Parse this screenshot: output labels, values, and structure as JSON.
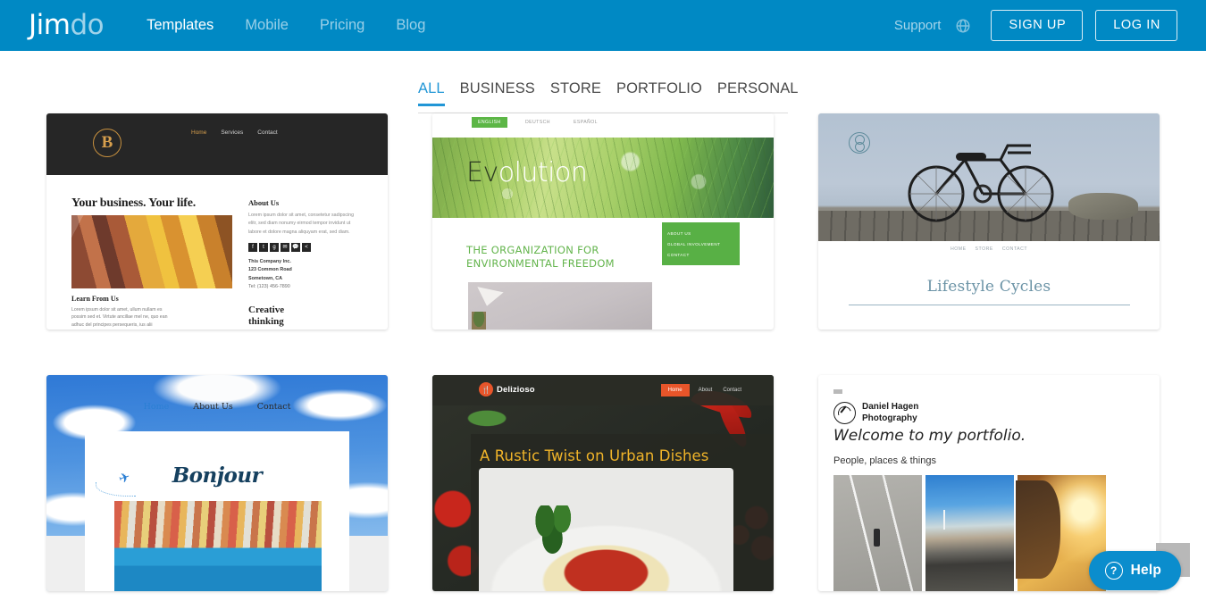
{
  "header": {
    "logo": {
      "part1": "Jim",
      "part2": "do"
    },
    "nav": [
      {
        "label": "Templates",
        "active": true
      },
      {
        "label": "Mobile",
        "active": false
      },
      {
        "label": "Pricing",
        "active": false
      },
      {
        "label": "Blog",
        "active": false
      }
    ],
    "support_label": "Support",
    "globe_icon": "globe-icon",
    "signup_label": "SIGN UP",
    "login_label": "LOG IN",
    "background_color": "#0089c4"
  },
  "tabs": {
    "items": [
      {
        "label": "ALL",
        "active": true
      },
      {
        "label": "BUSINESS",
        "active": false
      },
      {
        "label": "STORE",
        "active": false
      },
      {
        "label": "PORTFOLIO",
        "active": false
      },
      {
        "label": "PERSONAL",
        "active": false
      }
    ],
    "active_color": "#2196d6",
    "inactive_color": "#4a4a4a"
  },
  "templates": [
    {
      "id": "business-dark",
      "monogram": "B",
      "nav": [
        "Home",
        "Services",
        "Contact"
      ],
      "headline": "Your business. Your life.",
      "section_heading": "Learn From Us",
      "body_text": "Lorem ipsum dolor sit amet, ullum nullam es possim sed et. Virtute ancillae mel ne, quo ean adhuc del principes persequeris, ius alii",
      "pull_quote_line1": "Creative",
      "pull_quote_line2": "thinking",
      "aside_heading": "About Us",
      "aside_text": "Lorem ipsum dolor sit amet, consetetur sadipscing elitr, sed diam nonumy eirmod tempor invidunt ut labore et dolore magna aliquyam erat, sed diam.",
      "social_icons": [
        "facebook-icon",
        "twitter-icon",
        "google-plus-icon",
        "mail-icon",
        "comment-icon",
        "share-icon"
      ],
      "company": "This Company Inc.",
      "street": "123 Common Road",
      "city": "Sometown, CA",
      "tel": "Tel: (123) 456-7890",
      "accent_color": "#d79f4d"
    },
    {
      "id": "evolution",
      "languages": [
        "ENGLISH",
        "DEUTSCH",
        "ESPAÑOL"
      ],
      "hero_word_dark": "Ev",
      "hero_word_light": "olution",
      "tagline_line1": "THE ORGANIZATION FOR",
      "tagline_line2": "ENVIRONMENTAL FREEDOM",
      "menu": [
        "ABOUT US",
        "GLOBAL INVOLVEMENT",
        "CONTACT"
      ],
      "accent_color": "#58b045"
    },
    {
      "id": "lifestyle-cycles",
      "logo_icon": "wheel-icon",
      "nav": [
        "HOME",
        "STORE",
        "CONTACT"
      ],
      "title": "Lifestyle Cycles",
      "accent_color": "#6b93a6"
    },
    {
      "id": "bonjour",
      "nav": [
        "Home",
        "About Us",
        "Contact"
      ],
      "brand": "Bonjour",
      "plane_icon": "airplane-icon",
      "accent_color": "#2b7fd4"
    },
    {
      "id": "delizioso",
      "brand": "Delizioso",
      "logo_icon": "fork-circle-icon",
      "nav": [
        "Home",
        "About",
        "Contact"
      ],
      "headline": "A Rustic Twist on Urban Dishes",
      "accent_color": "#e8552a",
      "headline_color": "#f0b429"
    },
    {
      "id": "daniel-hagen-photography",
      "menu_icon": "hamburger-icon",
      "logo_icon": "aperture-icon",
      "brand_line1": "Daniel Hagen",
      "brand_line2": "Photography",
      "welcome": "Welcome to my portfolio.",
      "subtitle": "People, places & things",
      "thumbnails": [
        "crosswalk-photo",
        "wind-turbines-photo",
        "sunset-portrait-photo"
      ]
    }
  ],
  "widgets": {
    "help_label": "Help",
    "help_icon": "question-circle-icon",
    "help_color": "#0b8dcd",
    "scroll_top_icon": "scroll-to-top-button"
  }
}
